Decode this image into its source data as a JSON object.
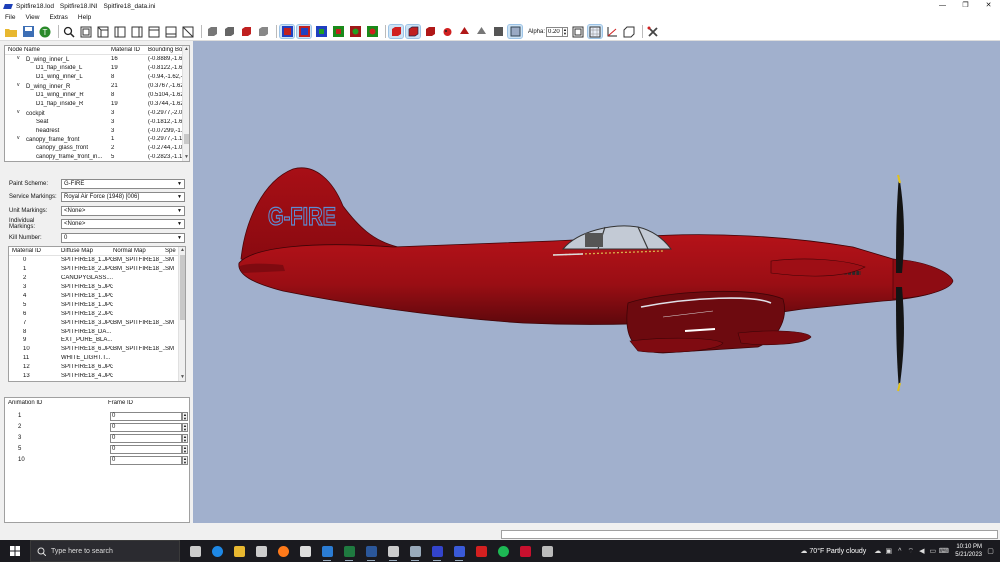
{
  "window": {
    "files": [
      "Spitfire18.lod",
      "Spitfire18.INI",
      "Spitfire18_data.ini"
    ],
    "controls": [
      "—",
      "❐",
      "✕"
    ]
  },
  "menu": [
    "File",
    "View",
    "Extras",
    "Help"
  ],
  "toolbar": {
    "alpha_label": "Alpha:",
    "alpha_value": "0.20"
  },
  "node_tree": {
    "columns": [
      "Node Name",
      "Material ID",
      "Bounding Bo"
    ],
    "rows": [
      {
        "name": "D_wing_inner_L",
        "mat": "16",
        "bb": "(-0.8889,-1.6",
        "indent": 1,
        "exp": "v"
      },
      {
        "name": "D1_flap_inside_L",
        "mat": "19",
        "bb": "(-0.8122,-1.6",
        "indent": 2,
        "exp": ""
      },
      {
        "name": "D1_wing_inner_L",
        "mat": "8",
        "bb": "(-0.94,-1.62,-",
        "indent": 2,
        "exp": ""
      },
      {
        "name": "D_wing_inner_R",
        "mat": "21",
        "bb": "(0.3767,-1.62",
        "indent": 1,
        "exp": "v"
      },
      {
        "name": "D1_wing_inner_R",
        "mat": "8",
        "bb": "(0.5104,-1.62",
        "indent": 2,
        "exp": ""
      },
      {
        "name": "D1_flap_inside_R",
        "mat": "19",
        "bb": "(0.3744,-1.62",
        "indent": 2,
        "exp": ""
      },
      {
        "name": "cockpit",
        "mat": "3",
        "bb": "(-0.2977,-2.0",
        "indent": 1,
        "exp": "v"
      },
      {
        "name": "Seat",
        "mat": "3",
        "bb": "(-0.1812,-1.6",
        "indent": 2,
        "exp": ""
      },
      {
        "name": "headrest",
        "mat": "3",
        "bb": "(-0.07299,-1.",
        "indent": 2,
        "exp": ""
      },
      {
        "name": "canopy_frame_front",
        "mat": "1",
        "bb": "(-0.2977,-1.1",
        "indent": 1,
        "exp": "v"
      },
      {
        "name": "canopy_glass_front",
        "mat": "2",
        "bb": "(-0.2744,-1.0",
        "indent": 2,
        "exp": ""
      },
      {
        "name": "canopy_frame_front_in...",
        "mat": "5",
        "bb": "(-0.2823,-1.1",
        "indent": 2,
        "exp": ""
      }
    ]
  },
  "markings": [
    {
      "label": "Paint Scheme:",
      "value": "G-FIRE"
    },
    {
      "label": "Service Markings:",
      "value": "Royal Air Force (1948) [006]"
    },
    {
      "label": "Unit Markings:",
      "value": "<None>"
    },
    {
      "label": "Individual Markings:",
      "value": "<None>"
    },
    {
      "label": "Kill Number:",
      "value": "0"
    }
  ],
  "materials": {
    "columns": [
      "Material ID",
      "Diffuse Map",
      "Normal Map",
      "Spe"
    ],
    "rows": [
      [
        "0",
        "SPITFIRE18_1.JPG",
        "BM_SPITFIRE18_...",
        "SM"
      ],
      [
        "1",
        "SPITFIRE18_2.JPG",
        "BM_SPITFIRE18_...",
        "SM"
      ],
      [
        "2",
        "CANOPYGLASS....",
        "",
        ""
      ],
      [
        "3",
        "SPITFIRE18_5.JPG",
        "",
        ""
      ],
      [
        "4",
        "SPITFIRE18_1.JPG",
        "",
        ""
      ],
      [
        "5",
        "SPITFIRE18_1.JPG",
        "",
        ""
      ],
      [
        "6",
        "SPITFIRE18_2.JPG",
        "",
        ""
      ],
      [
        "7",
        "SPITFIRE18_3.JPG",
        "BM_SPITFIRE18_...",
        "SM"
      ],
      [
        "8",
        "SPITFIRE18_DA...",
        "",
        ""
      ],
      [
        "9",
        "EXT_PURE_BLA...",
        "",
        ""
      ],
      [
        "10",
        "SPITFIRE18_6.JPG",
        "BM_SPITFIRE18_...",
        "SM"
      ],
      [
        "11",
        "WHITE_LIGHT.T...",
        "",
        ""
      ],
      [
        "12",
        "SPITFIRE18_6.JPG",
        "",
        ""
      ],
      [
        "13",
        "SPITFIRE18_4.JPG",
        "",
        ""
      ]
    ]
  },
  "animation": {
    "columns": [
      "Animation ID",
      "Frame ID"
    ],
    "rows": [
      {
        "id": "1",
        "frame": "0"
      },
      {
        "id": "2",
        "frame": "0"
      },
      {
        "id": "3",
        "frame": "0"
      },
      {
        "id": "5",
        "frame": "0"
      },
      {
        "id": "10",
        "frame": "0"
      }
    ]
  },
  "viewport": {
    "registration": "G-FIRE",
    "colors": {
      "background": "#a1b0cd",
      "fuselage": "#9a0e14",
      "lettering": "#5a8fd6"
    }
  },
  "taskbar": {
    "search_placeholder": "Type here to search",
    "weather": "70°F  Partly cloudy",
    "time": "10:10 PM",
    "date": "5/21/2023",
    "icons": [
      "task-view-icon",
      "edge-icon",
      "file-explorer-icon",
      "store-icon",
      "firefox-icon",
      "notion-icon",
      "mail-icon",
      "excel-icon",
      "word-icon",
      "tz-app-icon",
      "steam-icon",
      "app-blue-icon",
      "lod-editor-icon",
      "acrobat-icon",
      "spotify-icon",
      "mcafee-icon",
      "misc-app-icon"
    ]
  }
}
